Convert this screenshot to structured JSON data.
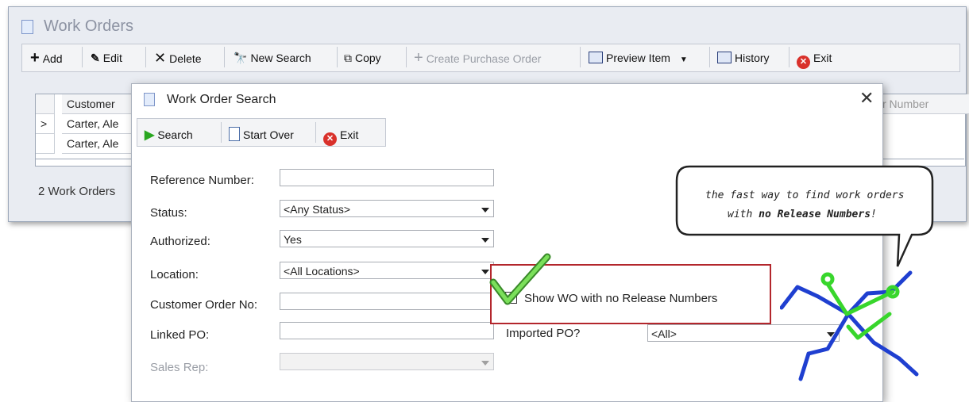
{
  "main": {
    "title": "Work Orders",
    "toolbar": {
      "add": "Add",
      "edit": "Edit",
      "delete": "Delete",
      "new_search": "New Search",
      "copy": "Copy",
      "create_po": "Create Purchase Order",
      "preview": "Preview Item",
      "history": "History",
      "exit": "Exit"
    },
    "grid": {
      "columns": [
        "Customer",
        "r Number"
      ],
      "rows": [
        {
          "indicator": ">",
          "customer": "Carter, Ale"
        },
        {
          "indicator": "",
          "customer": "Carter, Ale"
        }
      ]
    },
    "status": "2 Work Orders"
  },
  "dialog": {
    "title": "Work Order Search",
    "toolbar": {
      "search": "Search",
      "start_over": "Start Over",
      "exit": "Exit"
    },
    "fields": {
      "reference_number": {
        "label": "Reference Number:",
        "value": ""
      },
      "status": {
        "label": "Status:",
        "value": "<Any Status>"
      },
      "authorized": {
        "label": "Authorized:",
        "value": "Yes"
      },
      "location": {
        "label": "Location:",
        "value": "<All Locations>"
      },
      "customer_order_no": {
        "label": "Customer Order No:",
        "value": ""
      },
      "linked_po": {
        "label": "Linked PO:",
        "value": ""
      },
      "sales_rep": {
        "label": "Sales Rep:",
        "value": ""
      },
      "imported_po": {
        "label": "Imported PO?",
        "value": "<All>"
      },
      "show_wo_no_release": {
        "label": "Show WO with no Release Numbers",
        "checked": true
      }
    }
  },
  "callout": {
    "line1": "the fast way to find work orders",
    "line2_prefix": "with ",
    "line2_bold": "no Release Numbers",
    "line2_suffix": "!"
  },
  "colors": {
    "highlight_box": "#b3262c",
    "checkmark": "#6bd54a",
    "figure_blue": "#1f3fd0",
    "figure_green": "#38d62c",
    "exit_red": "#d9312b",
    "search_green": "#28a61f"
  }
}
